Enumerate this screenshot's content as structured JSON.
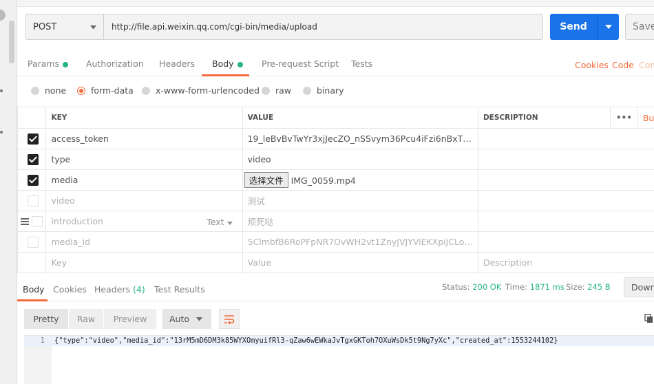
{
  "request": {
    "method": "POST",
    "url": "http://file.api.weixin.qq.com/cgi-bin/media/upload",
    "send_label": "Send",
    "save_label": "Save"
  },
  "tabs": [
    {
      "label": "Params",
      "dot": true
    },
    {
      "label": "Authorization",
      "dot": false
    },
    {
      "label": "Headers",
      "dot": false
    },
    {
      "label": "Body",
      "dot": true,
      "active": true
    },
    {
      "label": "Pre-request Script",
      "dot": false
    },
    {
      "label": "Tests",
      "dot": false
    }
  ],
  "right_links": {
    "cookies": "Cookies",
    "code": "Code",
    "comments": "Com"
  },
  "body_modes": [
    {
      "label": "none",
      "selected": false
    },
    {
      "label": "form-data",
      "selected": true
    },
    {
      "label": "x-www-form-urlencoded",
      "selected": false
    },
    {
      "label": "raw",
      "selected": false
    },
    {
      "label": "binary",
      "selected": false
    }
  ],
  "table": {
    "headers": {
      "key": "KEY",
      "value": "VALUE",
      "description": "DESCRIPTION",
      "more": "•••",
      "bulk": "Bu"
    },
    "rows": [
      {
        "checked": true,
        "key": "access_token",
        "value": "19_leBvBvTwYr3xjJecZO_nSSvym36Pcu4iFzi6nBxT…"
      },
      {
        "checked": true,
        "key": "type",
        "value": "video"
      },
      {
        "checked": true,
        "key": "media",
        "file_button": "选择文件",
        "value": "IMG_0059.mp4"
      },
      {
        "checked": false,
        "key": "video",
        "value": "测试"
      },
      {
        "checked": false,
        "key": "introduction",
        "type_label": "Text",
        "value": "烦死哒"
      },
      {
        "checked": false,
        "key": "media_id",
        "value": "5ClmbfB6RoPFpNR7OvWH2vt1ZnyJVJYViEKXpiJCLo…"
      }
    ],
    "placeholders": {
      "key": "Key",
      "value": "Value",
      "description": "Description"
    }
  },
  "response": {
    "tabs": [
      {
        "label": "Body",
        "active": true
      },
      {
        "label": "Cookies"
      },
      {
        "label": "Headers",
        "count": "(4)"
      },
      {
        "label": "Test Results"
      }
    ],
    "status_label": "Status:",
    "status_value": "200 OK",
    "time_label": "Time:",
    "time_value": "1871 ms",
    "size_label": "Size:",
    "size_value": "245 B",
    "download_label": "Down",
    "view_buttons": {
      "pretty": "Pretty",
      "raw": "Raw",
      "preview": "Preview",
      "format": "Auto"
    },
    "line_number": "1",
    "body_text": "{\"type\":\"video\",\"media_id\":\"13rM5mD6DM3k85WYXOmyuifRl3-qZaw6wEWkaJvTgxGKToh7OXuWsDk5t9Ng7yXc\",\"created_at\":1553244102}"
  },
  "colors": {
    "accent": "#f26b3a",
    "send": "#1a73e8",
    "ok": "#26b47f"
  }
}
